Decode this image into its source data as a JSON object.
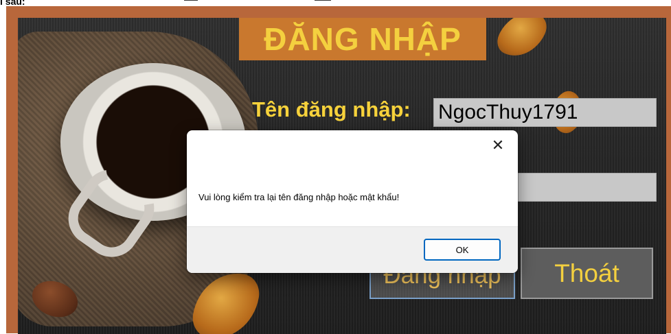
{
  "top_strip": {
    "text": "l sau:"
  },
  "form": {
    "title": "ĐĂNG NHẬP",
    "username_label": "Tên đăng nhập:",
    "username_value": "NgocThuy1791",
    "login_button": "Đăng nhập",
    "exit_button": "Thoát"
  },
  "dialog": {
    "close_icon": "close-icon",
    "message": "Vui lòng kiểm tra lại tên đăng nhập hoặc mật khẩu!",
    "ok_label": "OK"
  },
  "colors": {
    "frame": "#b8673b",
    "title_bg": "#c9782e",
    "title_text": "#f4d03f",
    "label_text": "#f7d23b",
    "ok_border": "#0067c0"
  }
}
